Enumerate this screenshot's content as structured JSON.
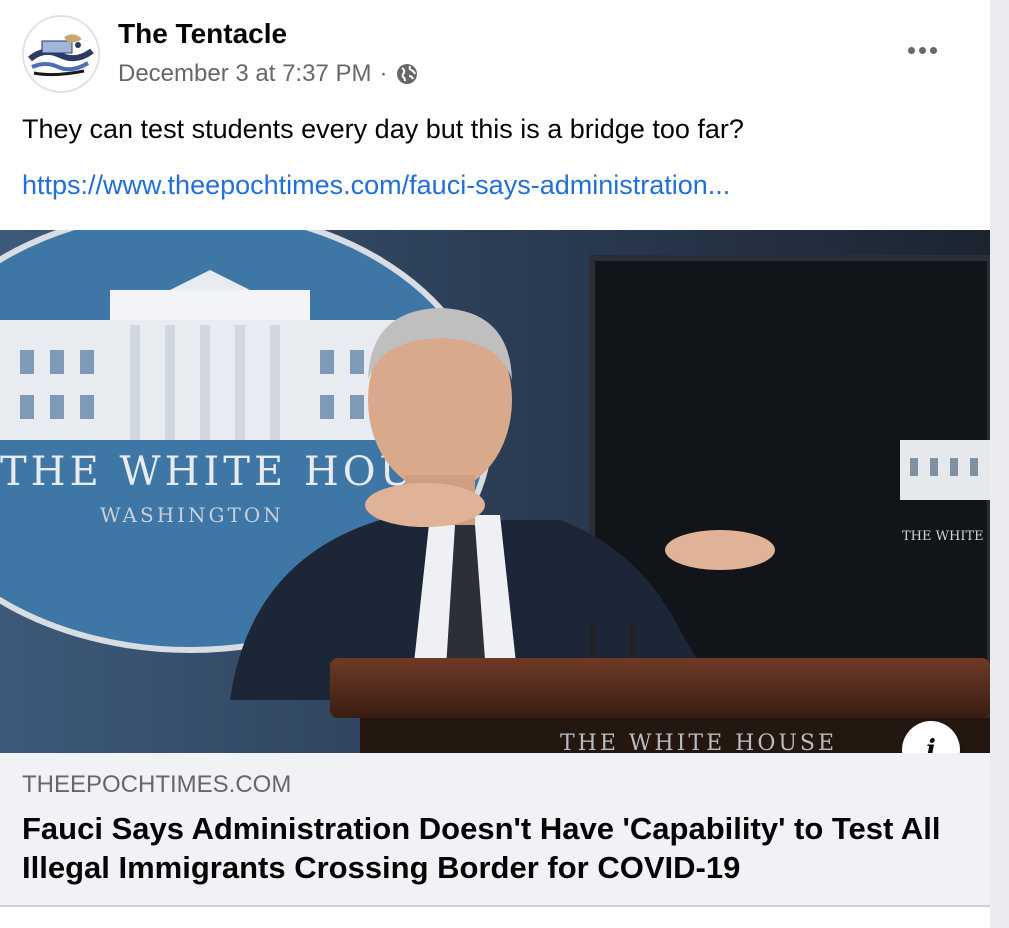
{
  "post": {
    "page_name": "The Tentacle",
    "timestamp": "December 3 at 7:37 PM",
    "separator": "·",
    "audience_icon": "globe-icon",
    "text": "They can test students every day but this is a bridge too far?",
    "link_text": "https://www.theepochtimes.com/fauci-says-administration..."
  },
  "image": {
    "seal_text": "THE WHITE HOUSE",
    "seal_subtext": "WASHINGTON",
    "screen_text": "THE WHITE",
    "podium_text": "THE WHITE HOUSE"
  },
  "link_preview": {
    "domain": "THEEPOCHTIMES.COM",
    "headline": "Fauci Says Administration Doesn't Have 'Capability' to Test All Illegal Immigrants Crossing Border for COVID-19",
    "info_icon": "info-icon",
    "info_label": "i"
  },
  "colors": {
    "link": "#216fdb",
    "secondary_text": "#65676b",
    "footer_bg": "#f0f2f5"
  }
}
